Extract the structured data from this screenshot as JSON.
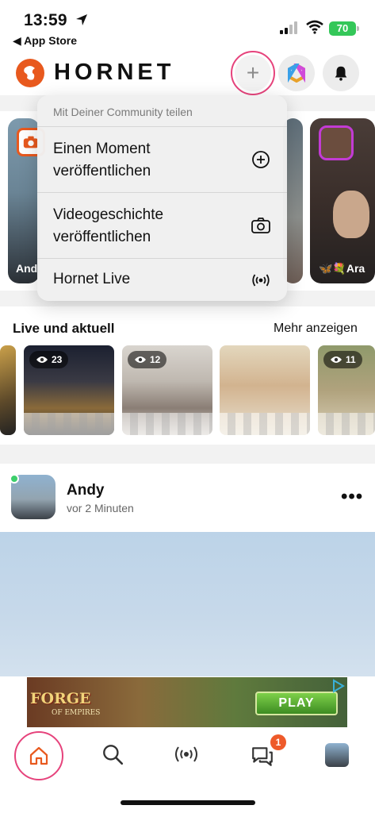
{
  "status_bar": {
    "time": "13:59",
    "back_label": "◀ App Store",
    "battery": "70"
  },
  "header": {
    "brand": "HORNET",
    "plus_symbol": "+",
    "icons": [
      "plus-icon",
      "hexagon-icon",
      "bell-icon"
    ],
    "accent_color": "#e8591e",
    "highlight_color": "#e6437c"
  },
  "stories": [
    {
      "name": "And"
    },
    {
      "name": ""
    },
    {
      "name": "🦋💐Ara"
    }
  ],
  "share_menu": {
    "header": "Mit Deiner Community teilen",
    "items": [
      {
        "label": "Einen Moment veröffentlichen",
        "icon": "plus-circle-icon"
      },
      {
        "label": "Videogeschichte veröffentlichen",
        "icon": "camera-icon"
      },
      {
        "label": "Hornet Live",
        "icon": "broadcast-icon"
      }
    ]
  },
  "live": {
    "title": "Live und aktuell",
    "more": "Mehr anzeigen",
    "cards": [
      {
        "views": ""
      },
      {
        "views": "23"
      },
      {
        "views": "12"
      },
      {
        "views": ""
      },
      {
        "views": "11"
      }
    ]
  },
  "post": {
    "author": "Andy",
    "time": "vor 2 Minuten",
    "more": "•••"
  },
  "ad": {
    "brand": "FORGE",
    "subtitle": "OF EMPIRES",
    "cta": "PLAY"
  },
  "tabbar": {
    "tabs": [
      "home-icon",
      "search-icon",
      "live-icon",
      "chat-icon",
      "profile-avatar"
    ],
    "chat_badge": "1"
  }
}
